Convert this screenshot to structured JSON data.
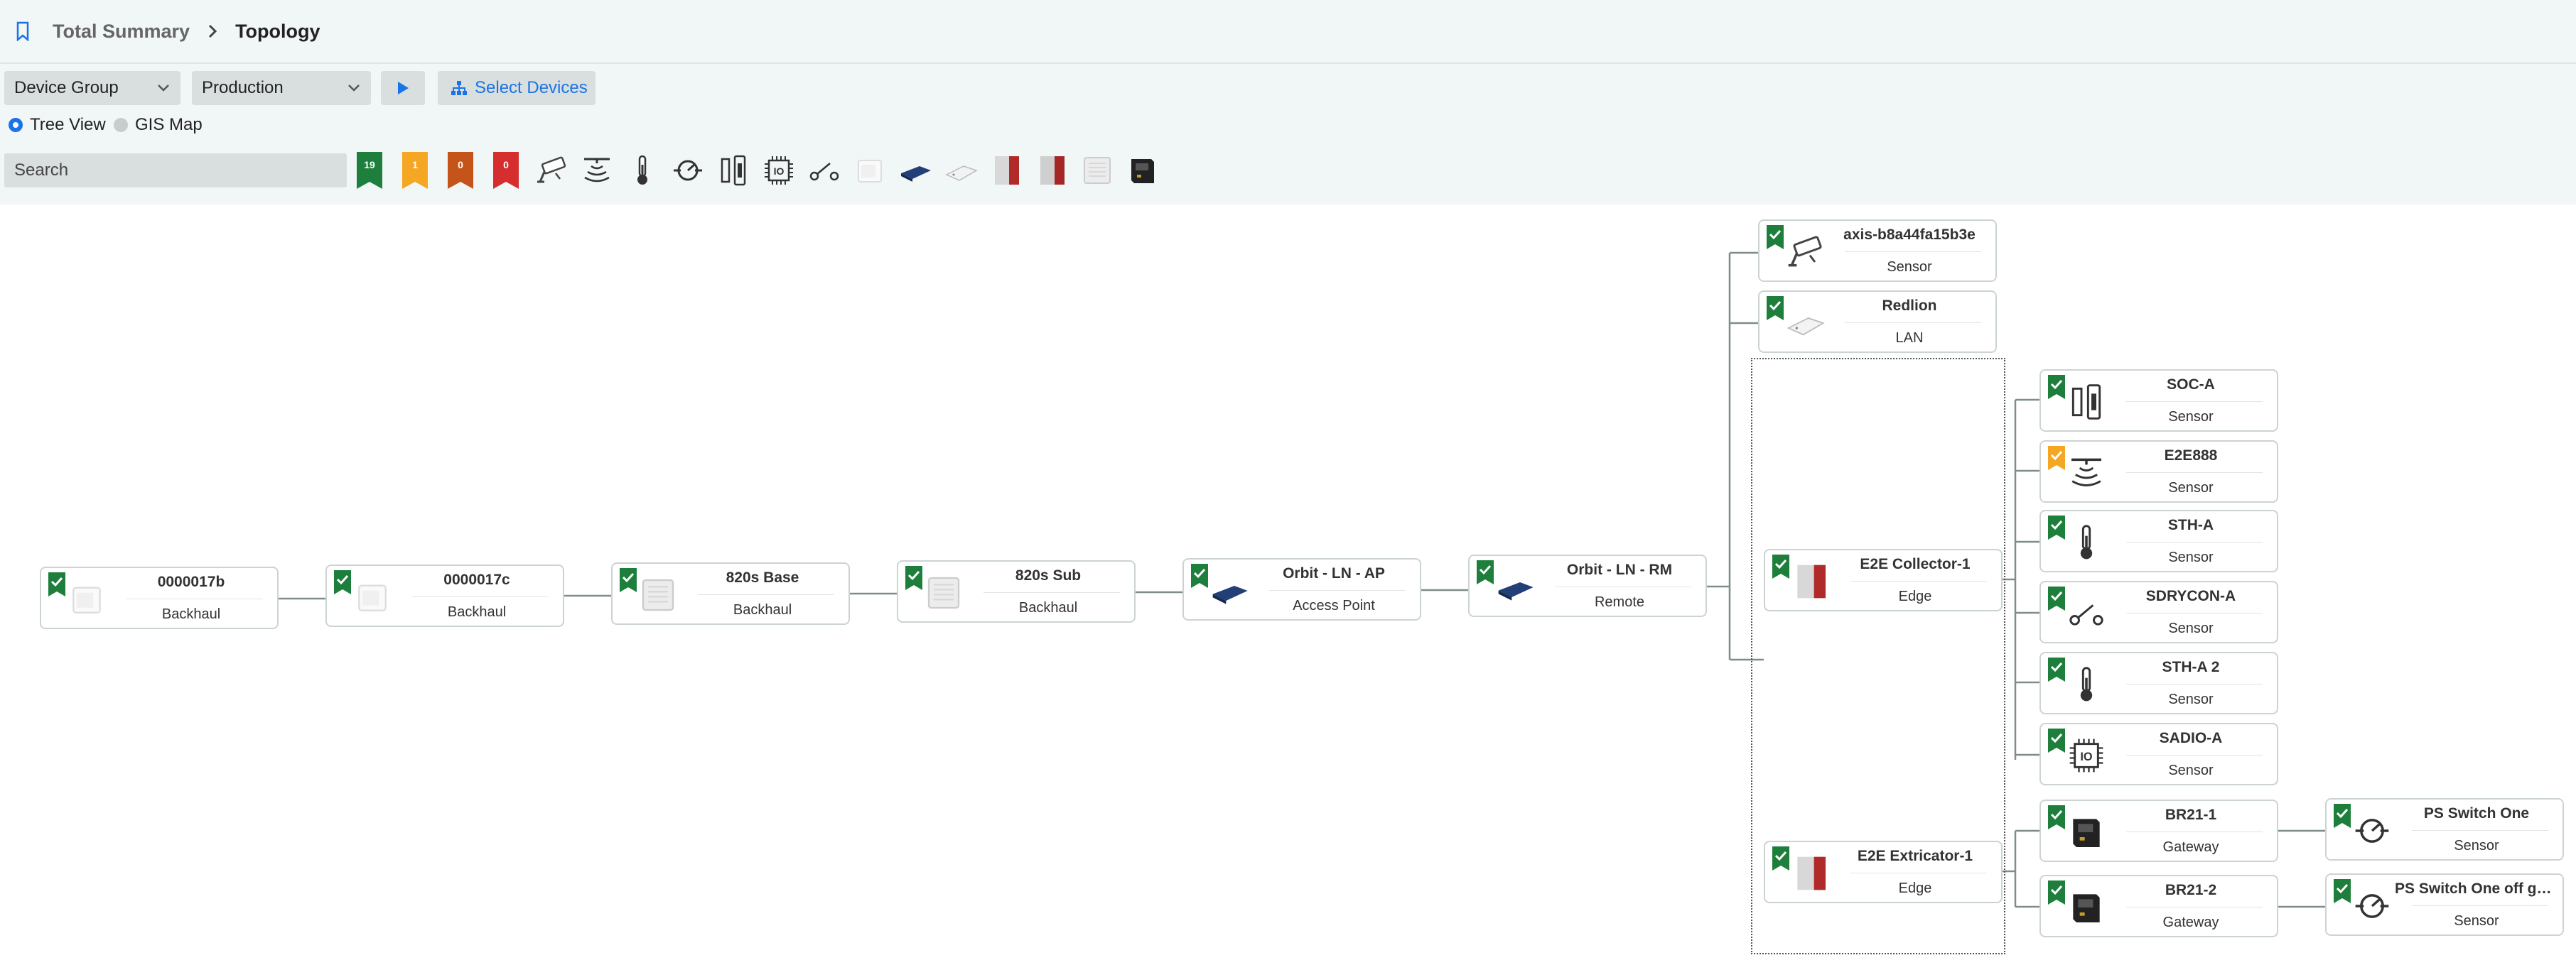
{
  "breadcrumb": {
    "root": "Total Summary",
    "current": "Topology"
  },
  "toolbar": {
    "group_select": "Device Group",
    "value_select": "Production",
    "select_devices": "Select Devices"
  },
  "view_options": {
    "tree": "Tree View",
    "gis": "GIS Map",
    "selected": "tree"
  },
  "search": {
    "placeholder": "Search"
  },
  "status_filters": {
    "ok": "19",
    "warning": "1",
    "error": "0",
    "critical": "0"
  },
  "colors": {
    "ok": "#1e7f3c",
    "warning": "#f5a623",
    "error": "#c4541a",
    "critical": "#d62e2e",
    "link": "#1a73e8",
    "connector": "#7f8c8c"
  },
  "nodes": {
    "n0000017b": {
      "name": "0000017b",
      "type": "Backhaul",
      "icon": "router-white-icon",
      "status": "ok"
    },
    "n0000017c": {
      "name": "0000017c",
      "type": "Backhaul",
      "icon": "router-white-icon",
      "status": "ok"
    },
    "base": {
      "name": "820s Base",
      "type": "Backhaul",
      "icon": "radio-box-icon",
      "status": "ok"
    },
    "sub": {
      "name": "820s Sub",
      "type": "Backhaul",
      "icon": "radio-box-icon",
      "status": "ok"
    },
    "ap": {
      "name": "Orbit - LN - AP",
      "type": "Access Point",
      "icon": "orbit-router-icon",
      "status": "ok"
    },
    "rm": {
      "name": "Orbit - LN - RM",
      "type": "Remote",
      "icon": "orbit-router-icon",
      "status": "ok"
    },
    "axis": {
      "name": "axis-b8a44fa15b3e",
      "type": "Sensor",
      "icon": "camera-icon",
      "status": "ok"
    },
    "redlion": {
      "name": "Redlion",
      "type": "LAN",
      "icon": "switch-icon",
      "status": "ok"
    },
    "collector": {
      "name": "E2E Collector-1",
      "type": "Edge",
      "icon": "edge-box-icon",
      "status": "ok"
    },
    "extricator": {
      "name": "E2E Extricator-1",
      "type": "Edge",
      "icon": "edge-box-icon",
      "status": "ok"
    },
    "soca": {
      "name": "SOC-A",
      "type": "Sensor",
      "icon": "door-sensor-icon",
      "status": "ok"
    },
    "e2e888": {
      "name": "E2E888",
      "type": "Sensor",
      "icon": "level-sensor-icon",
      "status": "warning"
    },
    "stha": {
      "name": "STH-A",
      "type": "Sensor",
      "icon": "thermometer-icon",
      "status": "ok"
    },
    "sdrycon": {
      "name": "SDRYCON-A",
      "type": "Sensor",
      "icon": "dry-contact-icon",
      "status": "ok"
    },
    "stha2": {
      "name": "STH-A 2",
      "type": "Sensor",
      "icon": "thermometer-icon",
      "status": "ok"
    },
    "sadio": {
      "name": "SADIO-A",
      "type": "Sensor",
      "icon": "io-chip-icon",
      "status": "ok"
    },
    "br211": {
      "name": "BR21-1",
      "type": "Gateway",
      "icon": "gateway-icon",
      "status": "ok"
    },
    "br212": {
      "name": "BR21-2",
      "type": "Gateway",
      "icon": "gateway-icon",
      "status": "ok"
    },
    "ps1": {
      "name": "PS Switch One",
      "type": "Sensor",
      "icon": "pressure-switch-icon",
      "status": "ok"
    },
    "ps2": {
      "name": "PS Switch One off gate...",
      "type": "Sensor",
      "icon": "pressure-switch-icon",
      "status": "ok"
    }
  }
}
